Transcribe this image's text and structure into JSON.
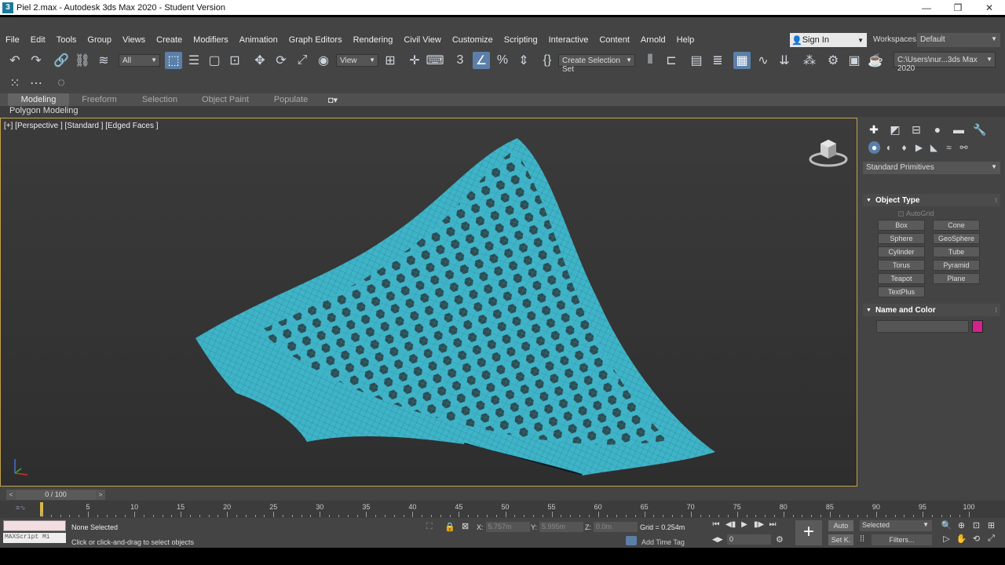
{
  "window": {
    "title": "Piel 2.max - Autodesk 3ds Max 2020 - Student Version",
    "app_icon": "3",
    "minimize": "—",
    "restore": "❐",
    "close": "✕"
  },
  "menu": [
    "File",
    "Edit",
    "Tools",
    "Group",
    "Views",
    "Create",
    "Modifiers",
    "Animation",
    "Graph Editors",
    "Rendering",
    "Civil View",
    "Customize",
    "Scripting",
    "Interactive",
    "Content",
    "Arnold",
    "Help"
  ],
  "account": {
    "sign_in": "Sign In",
    "workspaces_label": "Workspaces:",
    "workspace": "Default"
  },
  "toolbar": {
    "selection_filter": "All",
    "ref_coord": "View",
    "named_selection": "Create Selection Set",
    "project_path": "C:\\Users\\nur...3ds Max 2020"
  },
  "ribbon": {
    "tabs": [
      "Modeling",
      "Freeform",
      "Selection",
      "Object Paint",
      "Populate"
    ],
    "active_tab": "Modeling",
    "sub_panel": "Polygon Modeling"
  },
  "viewport": {
    "label": "[+] [Perspective ] [Standard ] [Edged Faces ]",
    "mesh_color": "#3fb4c8"
  },
  "command_panel": {
    "category": "Standard Primitives",
    "object_type_title": "Object Type",
    "autogrid": "AutoGrid",
    "buttons": [
      "Box",
      "Cone",
      "Sphere",
      "GeoSphere",
      "Cylinder",
      "Tube",
      "Torus",
      "Pyramid",
      "Teapot",
      "Plane",
      "TextPlus"
    ],
    "name_color_title": "Name and Color",
    "object_color": "#d3228a"
  },
  "timeline": {
    "frame_display": "0 / 100",
    "ticks": [
      5,
      10,
      15,
      20,
      25,
      30,
      35,
      40,
      45,
      50,
      55,
      60,
      65,
      70,
      75,
      80,
      85,
      90,
      95,
      100
    ]
  },
  "status": {
    "maxscript": "MAXScript Mi",
    "selection": "None Selected",
    "prompt": "Click or click-and-drag to select objects",
    "x_label": "X:",
    "x_value": "5.757m",
    "y_label": "Y:",
    "y_value": "5.995m",
    "z_label": "Z:",
    "z_value": "0.0m",
    "grid": "Grid = 0.254m",
    "add_time_tag": "Add Time Tag",
    "auto": "Auto",
    "set_key": "Set K.",
    "key_filter": "Selected",
    "filters": "Filters...",
    "current_frame": "0"
  }
}
